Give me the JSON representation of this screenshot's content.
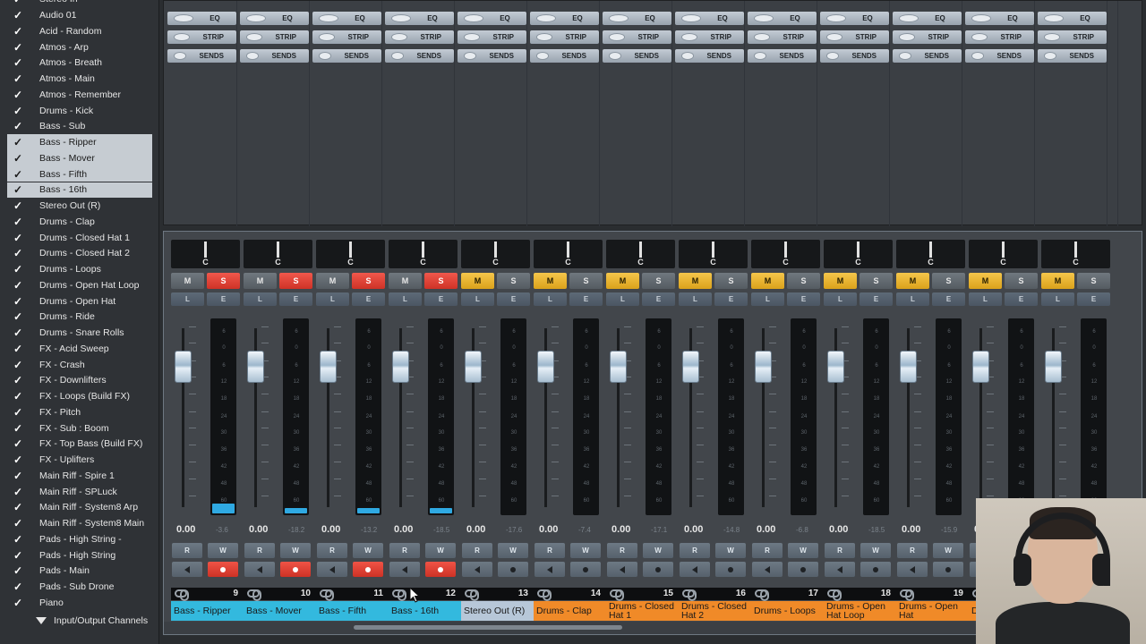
{
  "tracklist": {
    "items": [
      {
        "label": "Stereo In",
        "checked": true,
        "selected": false
      },
      {
        "label": "Audio 01",
        "checked": true,
        "selected": false
      },
      {
        "label": "Acid - Random",
        "checked": true,
        "selected": false
      },
      {
        "label": "Atmos - Arp",
        "checked": true,
        "selected": false
      },
      {
        "label": "Atmos - Breath",
        "checked": true,
        "selected": false
      },
      {
        "label": "Atmos - Main",
        "checked": true,
        "selected": false
      },
      {
        "label": "Atmos - Remember",
        "checked": true,
        "selected": false
      },
      {
        "label": "Drums - Kick",
        "checked": true,
        "selected": false
      },
      {
        "label": "Bass - Sub",
        "checked": true,
        "selected": false
      },
      {
        "label": "Bass - Ripper",
        "checked": true,
        "selected": true
      },
      {
        "label": "Bass - Mover",
        "checked": true,
        "selected": true
      },
      {
        "label": "Bass - Fifth",
        "checked": true,
        "selected": true
      },
      {
        "label": "Bass - 16th",
        "checked": true,
        "selected": true
      },
      {
        "label": "Stereo Out (R)",
        "checked": true,
        "selected": false
      },
      {
        "label": "Drums - Clap",
        "checked": true,
        "selected": false
      },
      {
        "label": "Drums - Closed Hat 1",
        "checked": true,
        "selected": false
      },
      {
        "label": "Drums - Closed Hat 2",
        "checked": true,
        "selected": false
      },
      {
        "label": "Drums - Loops",
        "checked": true,
        "selected": false
      },
      {
        "label": "Drums - Open Hat Loop",
        "checked": true,
        "selected": false
      },
      {
        "label": "Drums - Open Hat",
        "checked": true,
        "selected": false
      },
      {
        "label": "Drums - Ride",
        "checked": true,
        "selected": false
      },
      {
        "label": "Drums - Snare Rolls",
        "checked": true,
        "selected": false
      },
      {
        "label": "FX - Acid Sweep",
        "checked": true,
        "selected": false
      },
      {
        "label": "FX - Crash",
        "checked": true,
        "selected": false
      },
      {
        "label": "FX - Downlifters",
        "checked": true,
        "selected": false
      },
      {
        "label": "FX - Loops (Build FX)",
        "checked": true,
        "selected": false
      },
      {
        "label": "FX - Pitch",
        "checked": true,
        "selected": false
      },
      {
        "label": "FX - Sub : Boom",
        "checked": true,
        "selected": false
      },
      {
        "label": "FX - Top Bass (Build FX)",
        "checked": true,
        "selected": false
      },
      {
        "label": "FX - Uplifters",
        "checked": true,
        "selected": false
      },
      {
        "label": "Main Riff - Spire 1",
        "checked": true,
        "selected": false
      },
      {
        "label": "Main Riff - SPLuck",
        "checked": true,
        "selected": false
      },
      {
        "label": "Main Riff - System8 Arp",
        "checked": true,
        "selected": false
      },
      {
        "label": "Main Riff - System8 Main",
        "checked": true,
        "selected": false
      },
      {
        "label": "Pads - High String -",
        "checked": true,
        "selected": false
      },
      {
        "label": "Pads - High String",
        "checked": true,
        "selected": false
      },
      {
        "label": "Pads - Main",
        "checked": true,
        "selected": false
      },
      {
        "label": "Pads - Sub Drone",
        "checked": true,
        "selected": false
      },
      {
        "label": "Piano",
        "checked": true,
        "selected": false
      }
    ],
    "footer_label": "Input/Output Channels",
    "check_glyph": "✓"
  },
  "rack": {
    "buttons": [
      "EQ",
      "STRIP",
      "SENDS"
    ]
  },
  "mixer": {
    "mute_label": "M",
    "solo_label": "S",
    "listen_label": "L",
    "edit_label": "E",
    "read_label": "R",
    "write_label": "W",
    "pan_label": "C",
    "meter_scale": [
      "6",
      "0",
      "6",
      "12",
      "18",
      "24",
      "30",
      "36",
      "42",
      "48",
      "60"
    ],
    "colors": {
      "mute_on": "#f5c64b",
      "solo_on": "#e4463a",
      "bass": "#33b9de",
      "out": "#b7c7d8",
      "drums": "#f08a28",
      "meter": "#2fa9e2"
    },
    "channels": [
      {
        "number": "9",
        "name": "Bass - Ripper",
        "volume": "0.00",
        "peak": "-3.6",
        "muted": false,
        "soloed": true,
        "record": true,
        "color": "bass",
        "meter": 0.05
      },
      {
        "number": "10",
        "name": "Bass - Mover",
        "volume": "0.00",
        "peak": "-18.2",
        "muted": false,
        "soloed": true,
        "record": true,
        "color": "bass",
        "meter": 0.03
      },
      {
        "number": "11",
        "name": "Bass - Fifth",
        "volume": "0.00",
        "peak": "-13.2",
        "muted": false,
        "soloed": true,
        "record": true,
        "color": "bass",
        "meter": 0.03
      },
      {
        "number": "12",
        "name": "Bass - 16th",
        "volume": "0.00",
        "peak": "-18.5",
        "muted": false,
        "soloed": true,
        "record": true,
        "color": "bass",
        "meter": 0.03
      },
      {
        "number": "13",
        "name": "Stereo Out (R)",
        "volume": "0.00",
        "peak": "-17.6",
        "muted": true,
        "soloed": false,
        "record": false,
        "color": "out",
        "meter": 0
      },
      {
        "number": "14",
        "name": "Drums - Clap",
        "volume": "0.00",
        "peak": "-7.4",
        "muted": true,
        "soloed": false,
        "record": false,
        "color": "drums",
        "meter": 0
      },
      {
        "number": "15",
        "name": "Drums - Closed Hat 1",
        "volume": "0.00",
        "peak": "-17.1",
        "muted": true,
        "soloed": false,
        "record": false,
        "color": "drums",
        "meter": 0
      },
      {
        "number": "16",
        "name": "Drums - Closed Hat 2",
        "volume": "0.00",
        "peak": "-14.8",
        "muted": true,
        "soloed": false,
        "record": false,
        "color": "drums",
        "meter": 0
      },
      {
        "number": "17",
        "name": "Drums - Loops",
        "volume": "0.00",
        "peak": "-6.8",
        "muted": true,
        "soloed": false,
        "record": false,
        "color": "drums",
        "meter": 0
      },
      {
        "number": "18",
        "name": "Drums - Open Hat Loop",
        "volume": "0.00",
        "peak": "-18.5",
        "muted": true,
        "soloed": false,
        "record": false,
        "color": "drums",
        "meter": 0
      },
      {
        "number": "19",
        "name": "Drums - Open Hat",
        "volume": "0.00",
        "peak": "-15.9",
        "muted": true,
        "soloed": false,
        "record": false,
        "color": "drums",
        "meter": 0
      },
      {
        "number": "",
        "name": "D",
        "volume": "0",
        "peak": "",
        "muted": true,
        "soloed": false,
        "record": false,
        "color": "drums",
        "meter": 0
      },
      {
        "number": "",
        "name": "",
        "volume": "",
        "peak": "",
        "muted": true,
        "soloed": false,
        "record": false,
        "color": "drums",
        "meter": 0
      }
    ]
  }
}
